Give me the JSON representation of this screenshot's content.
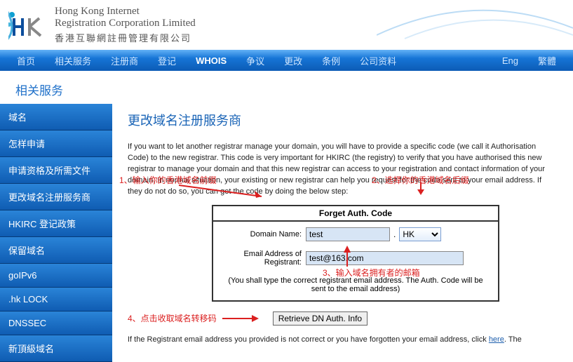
{
  "brand": {
    "en1": "Hong Kong Internet",
    "en2": "Registration Corporation Limited",
    "zh": "香港互聯網註冊管理有限公司"
  },
  "nav": {
    "items": [
      "首页",
      "相关服务",
      "注册商",
      "登记",
      "WHOIS",
      "争议",
      "更改",
      "条例",
      "公司资料"
    ],
    "active_idx": 4,
    "lang1": "Eng",
    "lang2": "繁體"
  },
  "section_title": "相关服务",
  "sidebar": {
    "items": [
      "域名",
      "怎样申请",
      "申请资格及所需文件",
      "更改域名注册服务商",
      "HKIRC 登记政策",
      "保留域名",
      "goIPv6",
      ".hk LOCK",
      "DNSSEC",
      "新頂級域名"
    ]
  },
  "main": {
    "title": "更改域名注册服务商",
    "intro": "If you want to let another registrar manage your domain, you will have to provide a specific code (we call it Authorisation Code) to the new registrar. This code is very important for HKIRC (the registry) to verify that you have authorised this new registrar to manage your domain and that this new registrar can access to your registration and contact information of your domain. In normal situation, your existing or new registrar can help you request for the code sent to your email address. If they do not do so, you can get the code by doing the below step:",
    "form": {
      "title": "Forget Auth. Code",
      "domain_label": "Domain Name:",
      "domain_value": "test",
      "tld": "HK",
      "email_label": "Email Address of Registrant:",
      "email_value": "test@163.com",
      "note": "(You shall type the correct registrant email address. The Auth. Code will be sent to the email address)"
    },
    "button_label": "Retrieve DN Auth. Info",
    "annots": {
      "a1": "1、输入你的香港域名前缀",
      "a2": "2、选择你的香港域名后缀",
      "a3": "3、输入域名拥有者的邮箱",
      "a4": "4、点击收取域名转移码"
    },
    "footer": {
      "pre": "If the Registrant email address you provided is not correct or you have forgotten your email address, click ",
      "link": "here",
      "post": ". The"
    }
  }
}
